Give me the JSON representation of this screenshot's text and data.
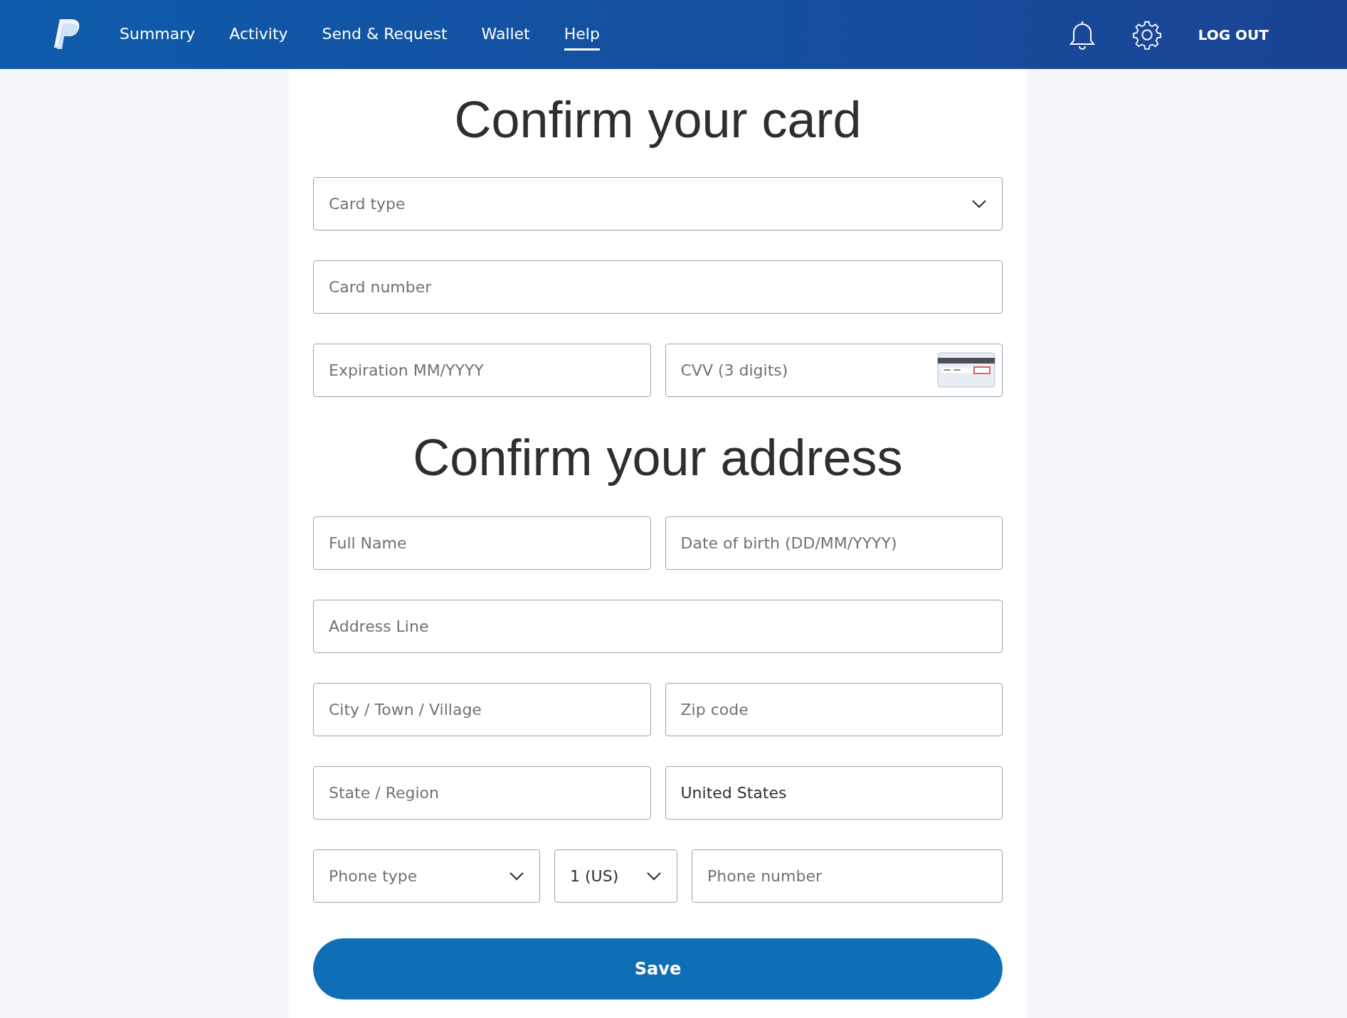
{
  "nav": {
    "items": [
      {
        "label": "Summary",
        "selected": false
      },
      {
        "label": "Activity",
        "selected": false
      },
      {
        "label": "Send & Request",
        "selected": false
      },
      {
        "label": "Wallet",
        "selected": false
      },
      {
        "label": "Help",
        "selected": true
      }
    ],
    "logout": "LOG OUT"
  },
  "sections": [
    {
      "title": "Confirm your card",
      "rows": [
        [
          {
            "kind": "select",
            "placeholder": "Card type"
          }
        ],
        [
          {
            "kind": "input",
            "placeholder": "Card number"
          }
        ],
        [
          {
            "kind": "input",
            "placeholder": "Expiration MM/YYYY"
          },
          {
            "kind": "card-icon-input",
            "placeholder": "CVV (3 digits)"
          }
        ]
      ]
    },
    {
      "title": "Confirm your address",
      "rows": [
        [
          {
            "kind": "input",
            "placeholder": "Full Name"
          },
          {
            "kind": "input",
            "placeholder": "Date of birth (DD/MM/YYYY)"
          }
        ],
        [
          {
            "kind": "input",
            "placeholder": "Address Line"
          }
        ],
        [
          {
            "kind": "input",
            "placeholder": "City / Town / Village"
          },
          {
            "kind": "input",
            "placeholder": "Zip code"
          }
        ],
        [
          {
            "kind": "input",
            "placeholder": "State / Region"
          },
          {
            "kind": "input",
            "value": "United States"
          }
        ],
        [
          {
            "kind": "select",
            "placeholder": "Phone type"
          },
          {
            "kind": "select",
            "value": "1 (US)"
          },
          {
            "kind": "input",
            "placeholder": "Phone number"
          }
        ]
      ]
    }
  ],
  "save_button": "Save"
}
